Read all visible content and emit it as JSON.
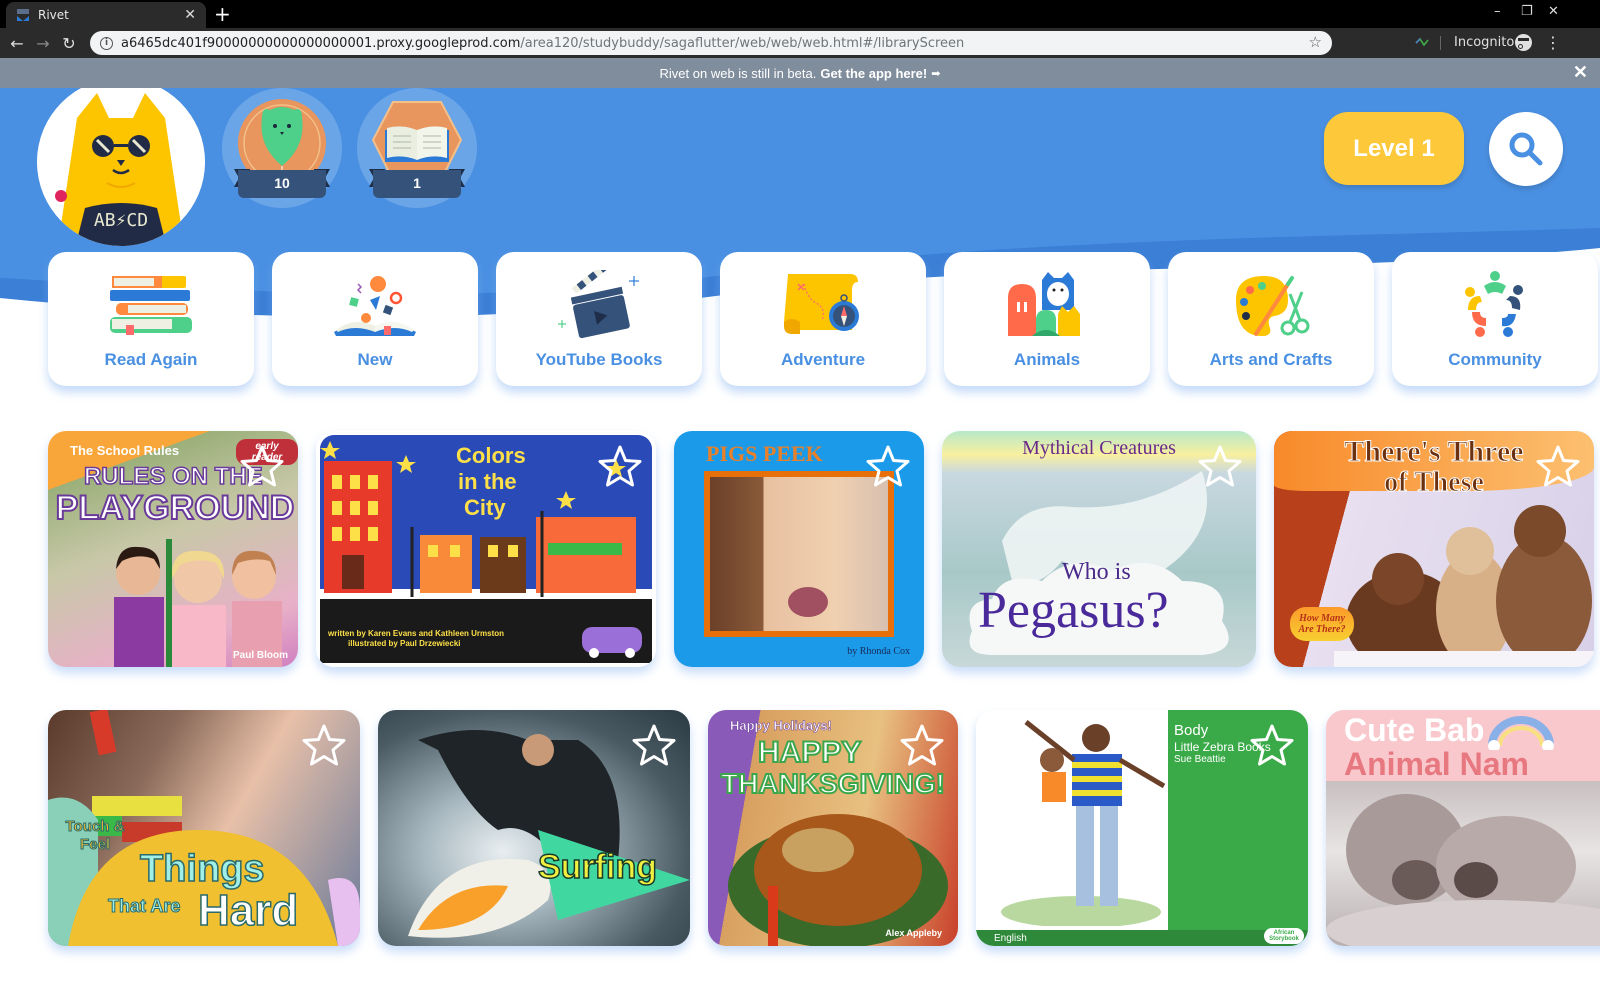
{
  "browser": {
    "tab_title": "Rivet",
    "new_tab": "+",
    "url_host": "a6465dc401f90000000000000000001.proxy.googleprod.com",
    "url_path": "/area120/studybuddy/sagaflutter/web/web/web.html#/libraryScreen",
    "profile_label": "Incognito",
    "window_controls": {
      "minimize": "–",
      "restore": "❐",
      "close": "✕"
    }
  },
  "banner": {
    "text": "Rivet on web is still in beta.",
    "cta": "Get the app here!",
    "arrow": "➡",
    "close": "✕"
  },
  "header": {
    "avatar_shirt_text": "AB⚡CD",
    "badges": [
      {
        "name": "balloon-badge",
        "count": "10"
      },
      {
        "name": "book-badge",
        "count": "1"
      }
    ],
    "level_label": "Level 1"
  },
  "colors": {
    "brand_blue": "#4a90e2",
    "level_yellow": "#fdc93a",
    "banner_gray": "#808d9c"
  },
  "categories": [
    {
      "label": "Read Again",
      "icon": "stacked-books-icon"
    },
    {
      "label": "New",
      "icon": "open-book-confetti-icon"
    },
    {
      "label": "YouTube Books",
      "icon": "clapperboard-icon"
    },
    {
      "label": "Adventure",
      "icon": "map-compass-icon"
    },
    {
      "label": "Animals",
      "icon": "animals-group-icon"
    },
    {
      "label": "Arts and Crafts",
      "icon": "palette-scissors-icon"
    },
    {
      "label": "Community",
      "icon": "community-circle-icon"
    }
  ],
  "books_row1": [
    {
      "series": "The School Rules",
      "title_line1": "RULES ON THE",
      "title_line2": "PLAYGROUND",
      "tag": "early reader",
      "author": "Paul Bloom"
    },
    {
      "title_line1": "Colors",
      "title_line2": "in the",
      "title_line3": "City",
      "credit1": "written by Karen Evans and Kathleen Urmston",
      "credit2": "illustrated by Paul Drzewiecki"
    },
    {
      "title": "PIGS PEEK",
      "author": "by Rhonda Cox"
    },
    {
      "series": "Mythical Creatures",
      "title_line1": "Who is",
      "title_line2": "Pegasus?"
    },
    {
      "title_line1": "There's Three",
      "title_line2": "of These",
      "sticker": "How Many Are There?"
    }
  ],
  "books_row2": [
    {
      "series": "Touch & Feel",
      "title_line1": "Things",
      "title_line2": "That Are",
      "title_line3": "Hard"
    },
    {
      "title": "Surfing"
    },
    {
      "series": "Happy Holidays!",
      "title_line1": "HAPPY",
      "title_line2": "THANKSGIVING!",
      "author": "Alex Appleby"
    },
    {
      "title": "Body",
      "publisher": "Little Zebra Books",
      "author": "Sue Beattie",
      "language": "English",
      "logo": "African Storybook"
    },
    {
      "title_line1": "Cute Bab",
      "title_line2": "Animal Nam"
    }
  ]
}
